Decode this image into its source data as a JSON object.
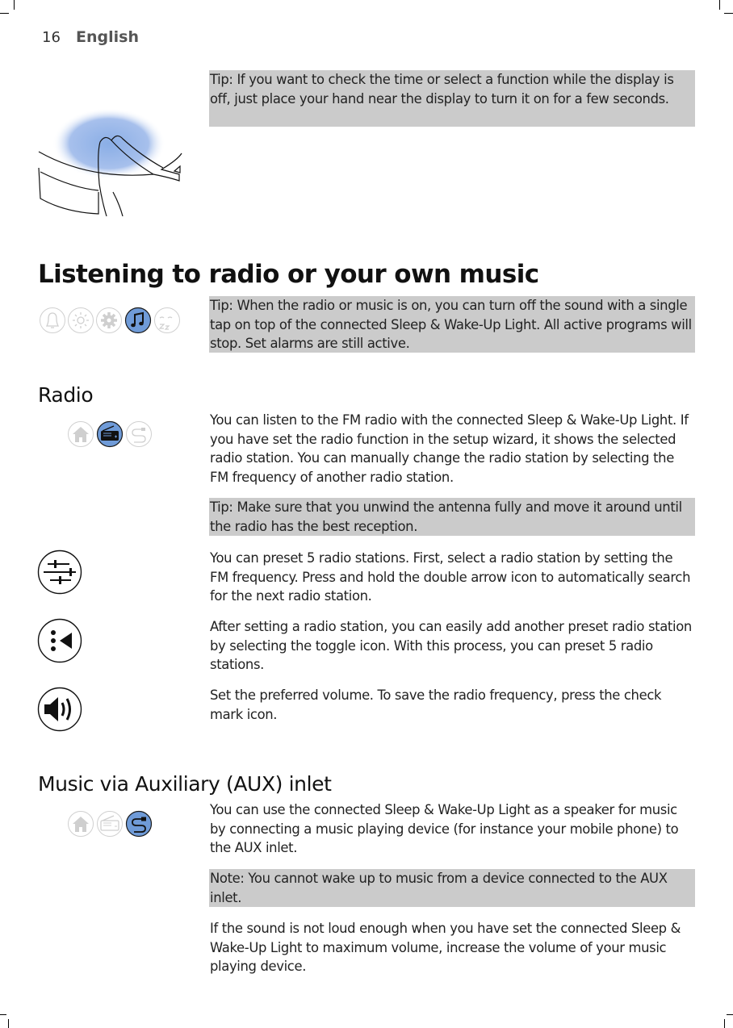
{
  "header": {
    "page_number": "16",
    "language": "English"
  },
  "intro_tip": "Tip: If you want to check the time or select a function while the display is off, just place your hand near the display to turn it on for a few seconds.",
  "illustration": "hand-near-display-illustration",
  "section": {
    "title": "Listening to radio or your own music",
    "menu_icons": [
      "bell-icon",
      "sun-icon",
      "gear-icon",
      "music-note-icon",
      "sleep-icon"
    ],
    "active_menu_icon": "music-note-icon",
    "tip": "Tip: When the radio or music is on, you can turn off the sound with a single tap on top of the connected Sleep & Wake-Up Light. All active programs will stop. Set alarms are still active."
  },
  "radio": {
    "title": "Radio",
    "source_icons": [
      "home-icon",
      "radio-icon",
      "aux-cable-icon"
    ],
    "active_source_icon": "radio-icon",
    "intro": "You can listen to the FM radio with the connected Sleep & Wake-Up Light. If you have set the radio function in the setup wizard, it shows the selected radio station. You can manually change the radio station by selecting the FM frequency of another radio station.",
    "tip": "Tip: Make sure that you unwind the antenna fully and move it around until the radio has the best reception.",
    "steps": [
      {
        "icon": "sliders-icon",
        "text": "You can preset 5 radio stations. First, select a radio station by setting the FM frequency. Press and hold the double arrow icon to automatically search for the next radio station."
      },
      {
        "icon": "preset-toggle-icon",
        "text": "After setting a radio station, you can easily add another preset radio station by selecting the toggle icon. With this process, you can preset 5 radio stations."
      },
      {
        "icon": "volume-icon",
        "text": "Set the preferred volume. To save the radio frequency, press the check mark icon."
      }
    ]
  },
  "aux": {
    "title": "Music via Auxiliary (AUX) inlet",
    "source_icons": [
      "home-icon",
      "radio-icon",
      "aux-cable-icon"
    ],
    "active_source_icon": "aux-cable-icon",
    "intro": "You can use the connected Sleep & Wake-Up Light as a speaker for music by connecting a music playing device (for instance your mobile phone) to the AUX inlet.",
    "note": "Note: You cannot wake up to music from a device connected to the AUX inlet.",
    "outro": "If the sound is not loud enough when you have set the connected Sleep & Wake-Up Light to maximum volume, increase the volume of your music playing device."
  },
  "colors": {
    "tip_background": "#cbcbcb",
    "active_icon": "#6f9bd8",
    "inactive_icon_stroke": "#d0d0d0"
  }
}
